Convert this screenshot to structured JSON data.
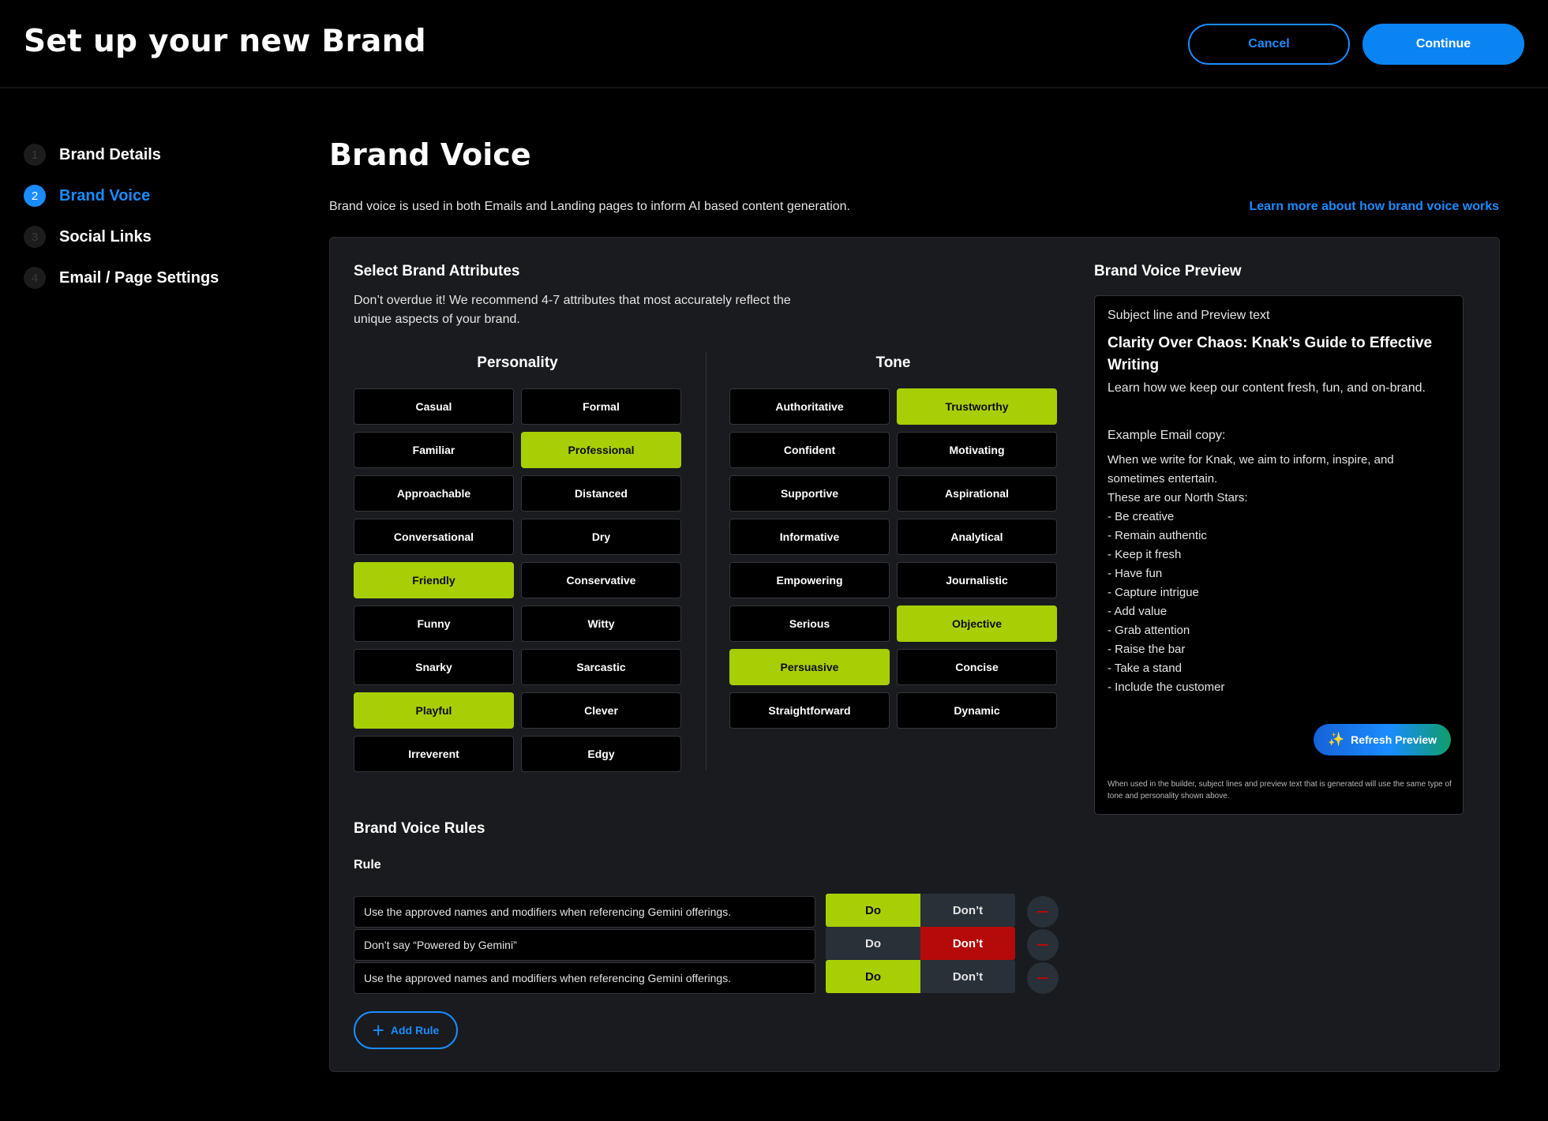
{
  "header": {
    "title": "Set up your new Brand",
    "cancel_label": "Cancel",
    "continue_label": "Continue"
  },
  "steps": [
    {
      "number": "1",
      "label": "Brand Details",
      "active": false
    },
    {
      "number": "2",
      "label": "Brand Voice",
      "active": true
    },
    {
      "number": "3",
      "label": "Social Links",
      "active": false
    },
    {
      "number": "4",
      "label": "Email / Page Settings",
      "active": false
    }
  ],
  "main": {
    "title": "Brand Voice",
    "description": "Brand voice is used in both Emails and Landing pages to inform AI based content generation.",
    "learn_more": "Learn more about how brand voice works"
  },
  "attributes": {
    "title": "Select Brand Attributes",
    "description": "Don’t overdue it! We recommend 4-7 attributes that most accurately reflect the unique aspects of your brand.",
    "personality": {
      "title": "Personality",
      "chips": [
        {
          "label": "Casual",
          "selected": false
        },
        {
          "label": "Formal",
          "selected": false
        },
        {
          "label": "Familiar",
          "selected": false
        },
        {
          "label": "Professional",
          "selected": true
        },
        {
          "label": "Approachable",
          "selected": false
        },
        {
          "label": "Distanced",
          "selected": false
        },
        {
          "label": "Conversational",
          "selected": false
        },
        {
          "label": "Dry",
          "selected": false
        },
        {
          "label": "Friendly",
          "selected": true
        },
        {
          "label": "Conservative",
          "selected": false
        },
        {
          "label": "Funny",
          "selected": false
        },
        {
          "label": "Witty",
          "selected": false
        },
        {
          "label": "Snarky",
          "selected": false
        },
        {
          "label": "Sarcastic",
          "selected": false
        },
        {
          "label": "Playful",
          "selected": true
        },
        {
          "label": "Clever",
          "selected": false
        },
        {
          "label": "Irreverent",
          "selected": false
        },
        {
          "label": "Edgy",
          "selected": false
        }
      ]
    },
    "tone": {
      "title": "Tone",
      "chips": [
        {
          "label": "Authoritative",
          "selected": false
        },
        {
          "label": "Trustworthy",
          "selected": true
        },
        {
          "label": "Confident",
          "selected": false
        },
        {
          "label": "Motivating",
          "selected": false
        },
        {
          "label": "Supportive",
          "selected": false
        },
        {
          "label": "Aspirational",
          "selected": false
        },
        {
          "label": "Informative",
          "selected": false
        },
        {
          "label": "Analytical",
          "selected": false
        },
        {
          "label": "Empowering",
          "selected": false
        },
        {
          "label": "Journalistic",
          "selected": false
        },
        {
          "label": "Serious",
          "selected": false
        },
        {
          "label": "Objective",
          "selected": true
        },
        {
          "label": "Persuasive",
          "selected": true
        },
        {
          "label": "Concise",
          "selected": false
        },
        {
          "label": "Straightforward",
          "selected": false
        },
        {
          "label": "Dynamic",
          "selected": false
        }
      ]
    }
  },
  "preview": {
    "title": "Brand Voice Preview",
    "label": "Subject line and Preview text",
    "headline": "Clarity Over Chaos: Knak’s Guide to Effective Writing",
    "subline": "Learn how we keep our content fresh, fun, and on-brand.",
    "example_label": "Example Email copy:",
    "body_lines": [
      "When we write for Knak, we aim to inform, inspire, and",
      "sometimes entertain.",
      "These are our North Stars:",
      "- Be creative",
      "- Remain authentic",
      "- Keep it fresh",
      "- Have fun",
      "- Capture intrigue",
      "- Add value",
      "- Grab attention",
      "- Raise the bar",
      "- Take a stand",
      "- Include the customer"
    ],
    "refresh_label": "Refresh Preview",
    "footnote": "When used in the builder, subject lines and preview text that is generated will use the same type of tone and personality shown above."
  },
  "rules": {
    "title": "Brand Voice Rules",
    "column_label": "Rule",
    "do_label": "Do",
    "dont_label": "Don’t",
    "items": [
      {
        "text": "Use the approved names and modifiers when referencing Gemini offerings.",
        "mode": "do"
      },
      {
        "text": "Don’t say “Powered by Gemini”",
        "mode": "dont"
      },
      {
        "text": "Use the approved names and modifiers when referencing Gemini offerings.",
        "mode": "do"
      }
    ],
    "add_label": "Add Rule"
  },
  "colors": {
    "accent_blue": "#1a8cff",
    "selected_green": "#a8cf06",
    "dont_red": "#b50a0a",
    "panel_bg": "#1a1b1e"
  }
}
